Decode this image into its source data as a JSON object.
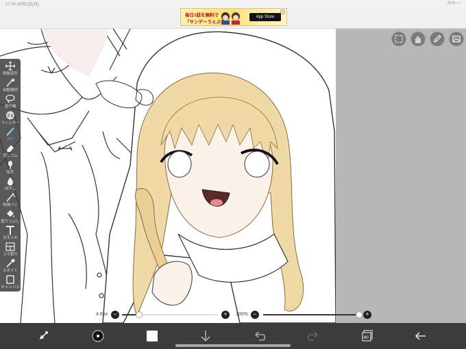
{
  "statusbar": {
    "time": "17:00  10月1日(日)",
    "battery": "21% ▭"
  },
  "ad": {
    "line1": "毎日1話を無料で",
    "line2": "「サンデーうぇぶり」",
    "store": " App Store",
    "info": "i"
  },
  "toolbar": {
    "items": [
      {
        "label": "移動変形",
        "icon": "move-icon"
      },
      {
        "label": "自動選択",
        "icon": "magic-wand-icon"
      },
      {
        "label": "投げ縄",
        "icon": "lasso-icon"
      },
      {
        "label": "フィルター",
        "icon": "filter-icon"
      },
      {
        "label": "ペン",
        "icon": "pen-icon",
        "active": true
      },
      {
        "label": "消しゴム",
        "icon": "eraser-icon"
      },
      {
        "label": "指先",
        "icon": "finger-icon"
      },
      {
        "label": "ぼかし",
        "icon": "blur-icon"
      },
      {
        "label": "特殊ペン",
        "icon": "special-pen-icon"
      },
      {
        "label": "塗りつぶし",
        "icon": "fill-icon"
      },
      {
        "label": "文字入れ",
        "icon": "text-icon"
      },
      {
        "label": "コマ割り",
        "icon": "frame-icon"
      },
      {
        "label": "スポイト",
        "icon": "eyedropper-icon"
      },
      {
        "label": "キャンバス",
        "icon": "canvas-icon"
      }
    ]
  },
  "top_icons": [
    "selection-icon",
    "hand-icon",
    "pen-edit-icon",
    "image-icon"
  ],
  "brush_size": {
    "value": "4.6px",
    "minus": "−",
    "plus": "+",
    "level": 0.18
  },
  "opacity": {
    "value": "100%",
    "minus": "−",
    "plus": "+",
    "level": 1.0
  },
  "bottombar": {
    "layer_count": "40",
    "icons": [
      "transform-icon",
      "brush-color-icon",
      "color-swatch-icon",
      "download-icon",
      "undo-icon",
      "redo-icon",
      "layers-icon",
      "back-arrow-icon"
    ]
  },
  "colors": {
    "toolbar": "#3c3c3c",
    "canvas_bg": "#ffffff",
    "gray_area": "#b7b7b7",
    "hair": "#efd9a6",
    "accent": "#7cc7ff"
  }
}
